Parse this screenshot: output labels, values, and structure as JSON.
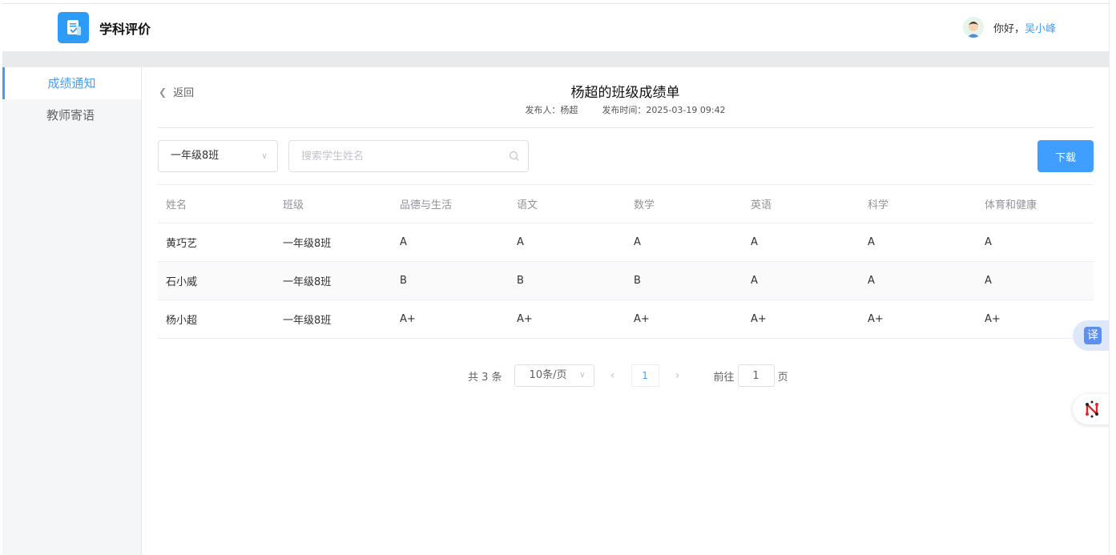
{
  "app": {
    "title": "学科评价"
  },
  "user": {
    "greeting": "你好，",
    "name": "吴小峰"
  },
  "sidebar": {
    "items": [
      {
        "label": "成绩通知",
        "active": true
      },
      {
        "label": "教师寄语",
        "active": false
      }
    ]
  },
  "report": {
    "back_label": "返回",
    "title": "杨超的班级成绩单",
    "publisher": "发布人：杨超",
    "publish_time": "发布时间：2025-03-19 09:42"
  },
  "filters": {
    "class_value": "一年级8班",
    "search_placeholder": "搜索学生姓名",
    "download_label": "下载"
  },
  "table": {
    "headers": [
      "姓名",
      "班级",
      "品德与生活",
      "语文",
      "数学",
      "英语",
      "科学",
      "体育和健康"
    ],
    "rows": [
      [
        "黄巧艺",
        "一年级8班",
        "A",
        "A",
        "A",
        "A",
        "A",
        "A"
      ],
      [
        "石小威",
        "一年级8班",
        "B",
        "B",
        "B",
        "A",
        "A",
        "A"
      ],
      [
        "杨小超",
        "一年级8班",
        "A+",
        "A+",
        "A+",
        "A+",
        "A+",
        "A+"
      ]
    ]
  },
  "pagination": {
    "total": "共 3 条",
    "page_size": "10条/页",
    "current_page": "1",
    "goto_label": "前往",
    "goto_value": "1",
    "page_suffix": "页"
  },
  "floating": {
    "translate_label": "译"
  },
  "colors": {
    "accent": "#409eff",
    "logo": "#2d9cf6"
  }
}
